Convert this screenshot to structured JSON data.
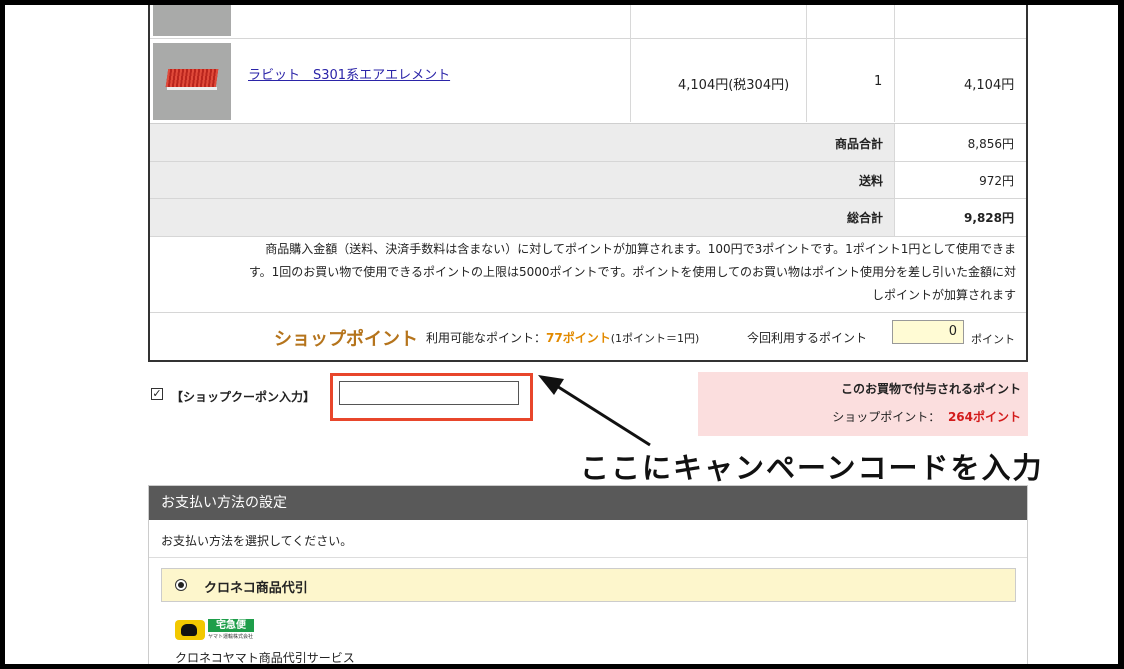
{
  "cart": {
    "item": {
      "name": "ラビット　S301系エアエレメント",
      "price": "4,104円(税304円)",
      "qty": "1",
      "subtotal": "4,104円"
    },
    "totals": [
      {
        "label": "商品合計",
        "value": "8,856円"
      },
      {
        "label": "送料",
        "value": "972円"
      },
      {
        "label": "総合計",
        "value": "9,828円"
      }
    ],
    "point_note_lines": [
      "商品購入金額（送料、決済手数料は含まない）に対してポイントが加算されます。100円で3ポイントです。1ポイント1円として使用できま",
      "す。1回のお買い物で使用できるポイントの上限は5000ポイントです。ポイントを使用してのお買い物はポイント使用分を差し引いた金額に対",
      "しポイントが加算されます"
    ],
    "shop_point": {
      "logo_text": "ショップポイント",
      "available_label": "利用可能なポイント：",
      "available_value": "77ポイント",
      "rate": "(1ポイント＝1円)",
      "use_label": "今回利用するポイント",
      "use_value": "0",
      "unit": "ポイント"
    }
  },
  "coupon": {
    "label": "【ショップクーポン入力】",
    "value": "",
    "checked": true
  },
  "earned": {
    "title": "このお買物で付与されるポイント",
    "label": "ショップポイント：",
    "value": "264ポイント"
  },
  "annotation": {
    "text": "ここにキャンペーンコードを入力"
  },
  "payment": {
    "header": "お支払い方法の設定",
    "instruction": "お支払い方法を選択してください。",
    "option_label": "クロネコ商品代引",
    "service_text": "クロネコヤマト商品代引サービス",
    "logo_badge": "宅急便",
    "logo_small": "ヤマト運輸株式会社"
  },
  "colors": {
    "coupon_highlight": "#e8462b",
    "points_orange": "#e28a00",
    "earned_red": "#d31b1b",
    "pink_panel": "#fbdede",
    "header_gray": "#595959",
    "option_yellow": "#fdf6cc"
  }
}
